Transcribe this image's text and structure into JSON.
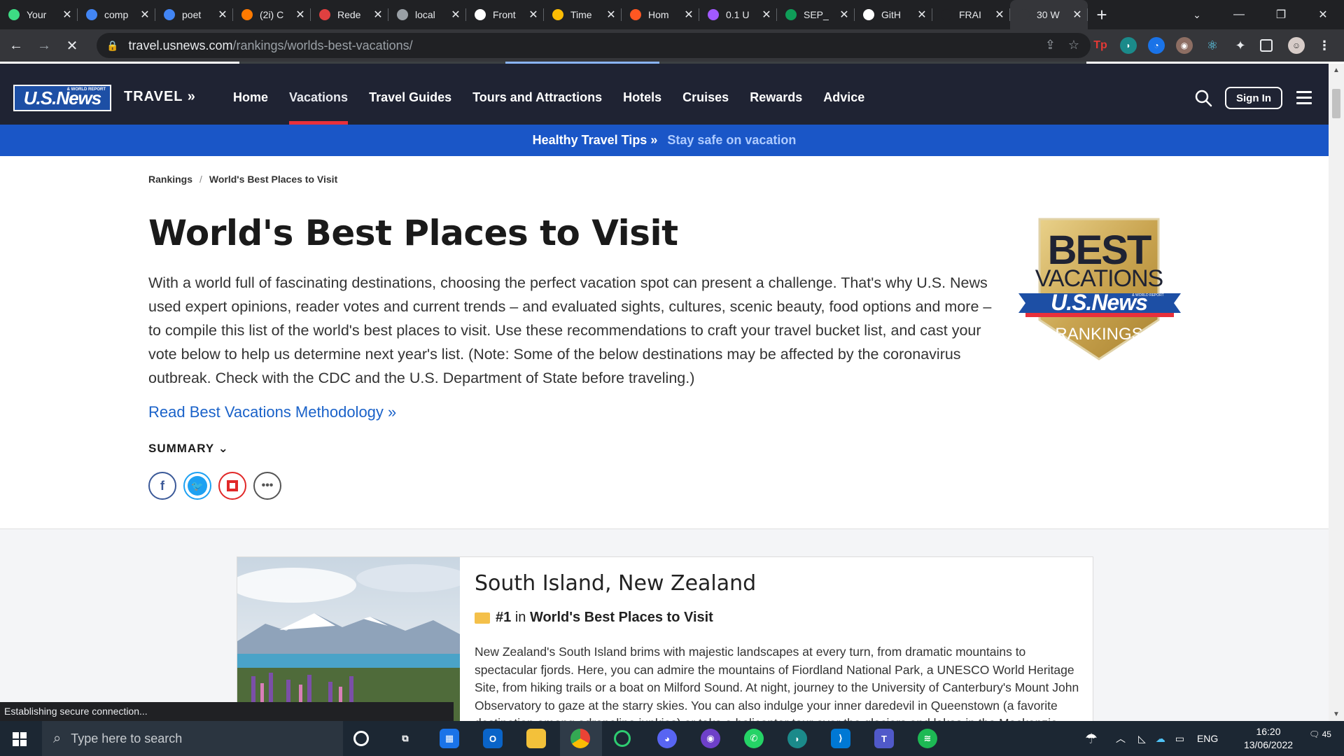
{
  "browser": {
    "tabs": [
      {
        "title": "Your",
        "icon": "leaf-icon",
        "color": "#3ddc84"
      },
      {
        "title": "comp",
        "icon": "google-icon",
        "color": "#4285f4"
      },
      {
        "title": "poet",
        "icon": "google-icon",
        "color": "#4285f4"
      },
      {
        "title": "(2i) C",
        "icon": "dots-icon",
        "color": "#ff7a00"
      },
      {
        "title": "Rede",
        "icon": "doc-icon",
        "color": "#e04040"
      },
      {
        "title": "local",
        "icon": "globe-icon",
        "color": "#9aa0a6"
      },
      {
        "title": "Front",
        "icon": "loop-icon",
        "color": "#ffffff"
      },
      {
        "title": "Time",
        "icon": "drive-icon",
        "color": "#fbbc04"
      },
      {
        "title": "Hom",
        "icon": "arc-icon",
        "color": "#ff5722"
      },
      {
        "title": "0.1 U",
        "icon": "figma-icon",
        "color": "#a259ff"
      },
      {
        "title": "SEP_",
        "icon": "sheets-icon",
        "color": "#0f9d58"
      },
      {
        "title": "GitH",
        "icon": "github-icon",
        "color": "#ffffff"
      },
      {
        "title": "FRAI",
        "icon": "f-icon",
        "color": "#202124"
      },
      {
        "title": "30 W",
        "icon": "loading-icon",
        "color": "#35363a",
        "active": true
      }
    ],
    "new_tab": "+",
    "address": {
      "host": "travel.usnews.com",
      "path": "/rankings/worlds-best-vacations/"
    },
    "status_text": "Establishing secure connection..."
  },
  "site": {
    "logo": "U.S.News",
    "logo_sub": "& WORLD REPORT",
    "section": "TRAVEL »",
    "nav": [
      {
        "label": "Home"
      },
      {
        "label": "Vacations",
        "active": true
      },
      {
        "label": "Travel Guides"
      },
      {
        "label": "Tours and Attractions"
      },
      {
        "label": "Hotels"
      },
      {
        "label": "Cruises"
      },
      {
        "label": "Rewards"
      },
      {
        "label": "Advice"
      }
    ],
    "sign_in": "Sign In",
    "promo_left": "Healthy Travel Tips »",
    "promo_right": "Stay safe on vacation"
  },
  "page": {
    "breadcrumb": [
      "Rankings",
      "World's Best Places to Visit"
    ],
    "breadcrumb_sep": "/",
    "title": "World's Best Places to Visit",
    "intro": "With a world full of fascinating destinations, choosing the perfect vacation spot can present a challenge. That's why U.S. News used expert opinions, reader votes and current trends – and evaluated sights, cultures, scenic beauty, food options and more – to compile this list of the world's best places to visit. Use these recommendations to craft your travel bucket list, and cast your vote below to help us determine next year's list. (Note: Some of the below destinations may be affected by the coronavirus outbreak. Check with the CDC and the U.S. Department of State before traveling.)",
    "methodology_link": "Read Best Vacations Methodology »",
    "summary": "SUMMARY",
    "badge": {
      "line1": "BEST",
      "line2": "VACATIONS",
      "line3": "U.S.News",
      "line4": "RANKINGS",
      "sub": "& WORLD REPORT"
    }
  },
  "listing": {
    "name": "South Island, New Zealand",
    "rank": "#1",
    "rank_in": "in",
    "rank_list": "World's Best Places to Visit",
    "description": "New Zealand's South Island brims with majestic landscapes at every turn, from dramatic mountains to spectacular fjords. Here, you can admire the mountains of Fiordland National Park, a UNESCO World Heritage Site, from hiking trails or a boat on Milford Sound. At night, journey to the University of Canterbury's Mount John Observatory to gaze at the starry skies. You can also indulge your inner daredevil in Queenstown (a favorite destination among adrenaline junkies) or take a helicopter tour over the glaciers and lakes in the Mackenzie region."
  },
  "taskbar": {
    "search_placeholder": "Type here to search",
    "lang": "ENG",
    "time": "16:20",
    "date": "13/06/2022",
    "notifications": "45"
  },
  "colors": {
    "nav_bg": "#1f2333",
    "promo_bg": "#1a56c7",
    "accent_red": "#e8303b",
    "link_blue": "#1a62c9"
  }
}
